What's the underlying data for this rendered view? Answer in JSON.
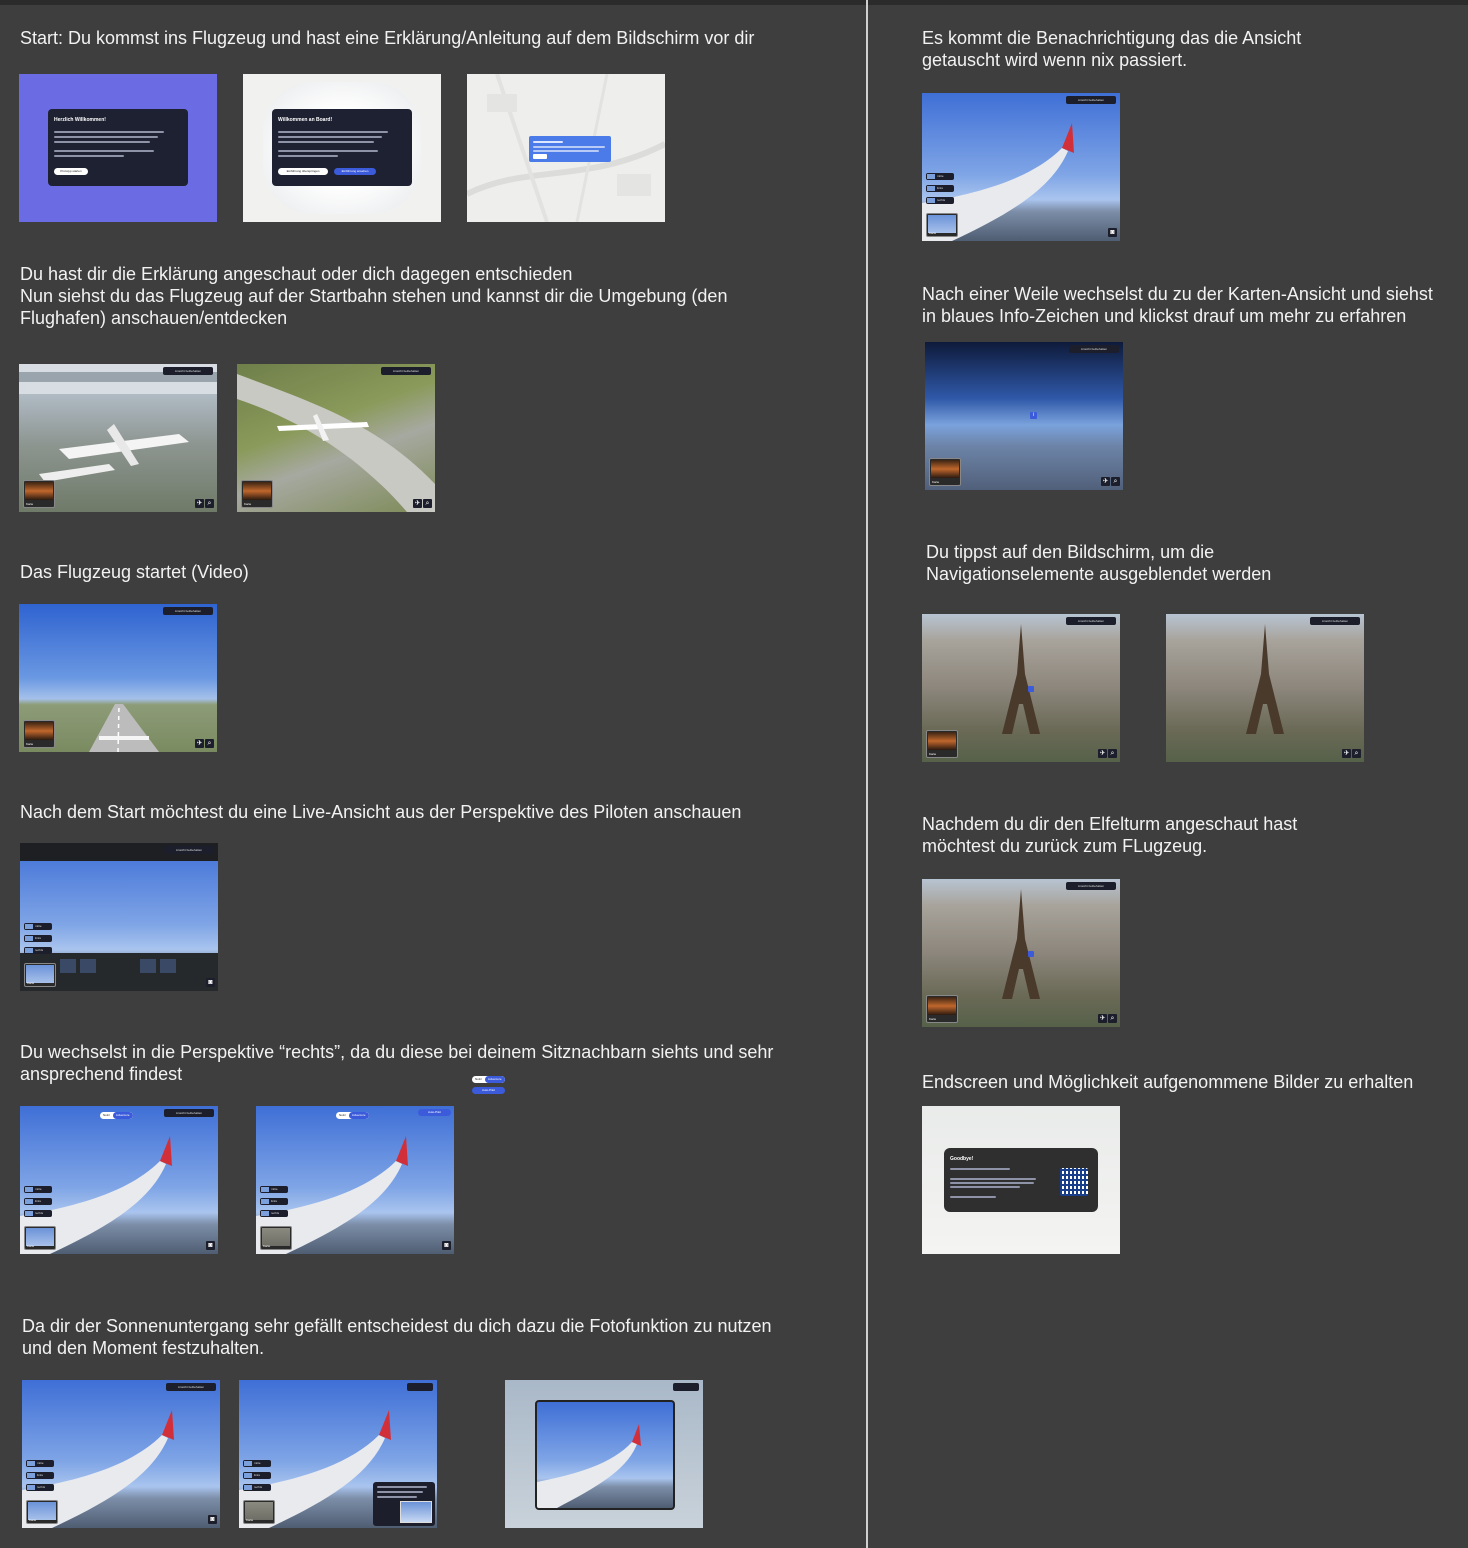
{
  "left_steps": [
    {
      "text": "Start: Du kommst ins Flugzeug und hast eine Erklärung/Anleitung auf dem Bildschirm vor dir"
    },
    {
      "line1": "Du hast dir die Erklärung angeschaut oder dich dagegen entschieden",
      "line2": "Nun siehst du das Flugzeug auf der Startbahn stehen und kannst dir die Umgebung (den",
      "line3": "Flughafen) anschauen/entdecken"
    },
    {
      "text": "Das Flugzeug startet (Video)"
    },
    {
      "text": "Nach dem Start möchtest du eine Live-Ansicht aus der Perspektive des Piloten anschauen"
    },
    {
      "line1": "Du wechselst in die Perspektive “rechts”, da du diese bei deinem Sitznachbarn siehts und sehr",
      "line2": "ansprechend findest"
    },
    {
      "line1": "Da dir der Sonnenuntergang sehr gefällt entscheidest du dich dazu die Fotofunktion zu nutzen",
      "line2": "und den Moment festzuhalten."
    }
  ],
  "right_steps": [
    {
      "line1": "Es kommt die Benachrichtigung das die Ansicht",
      "line2": "getauscht wird wenn nix passiert."
    },
    {
      "line1": "Nach einer Weile wechselst du zu der Karten-Ansicht und siehst",
      "line2": "in blaues Info-Zeichen und klickst drauf um mehr zu erfahren"
    },
    {
      "line1": "Du tippst auf den Bildschirm, um die",
      "line2": "Navigationselemente ausgeblendet werden"
    },
    {
      "line1": "Nachdem du dir den Elfelturm angeschaut hast",
      "line2": "möchtest du zurück zum FLugzeug."
    },
    {
      "text": "Endscreen und Möglichkeit aufgenommene Bilder zu erhalten"
    }
  ],
  "screens": {
    "welcome1": {
      "title": "Herzlich Willkommen!",
      "button": "Prototyp starten"
    },
    "welcome2": {
      "title": "Willkommen an Board!",
      "button_skip": "Einführung überspringen",
      "button_start": "Einführung ansehen"
    },
    "goodbye": {
      "title": "Goodbye!"
    },
    "cam_label": "Karte",
    "topbtn_label": "Ansicht beibehalten",
    "toggle_left": "Notiz",
    "toggle_right": "Adventure",
    "auto_pilot": "Auto-Pilot",
    "persp_labels": [
      "mitte",
      "links",
      "rechts"
    ]
  },
  "colors": {
    "background": "#3e3e3e",
    "accent": "#3b5bdb",
    "violet": "#6b6be3",
    "divider": "#cfcfcf",
    "wing_tip": "#d1303a"
  }
}
